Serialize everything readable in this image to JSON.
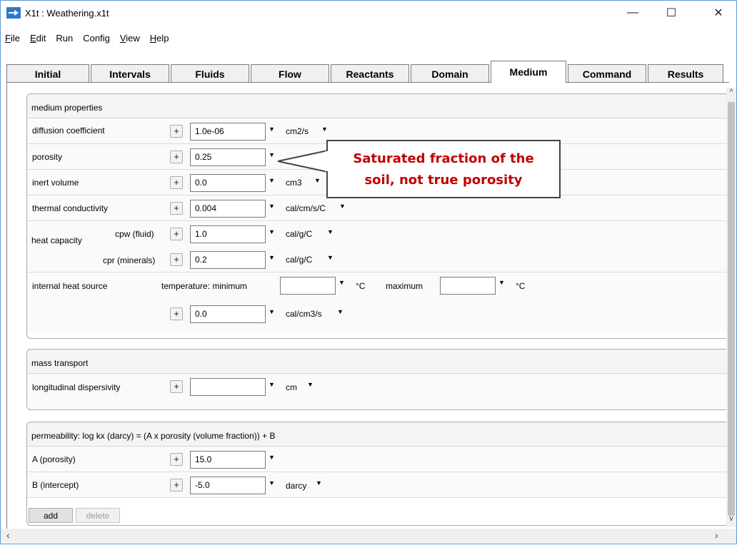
{
  "window": {
    "title": "X1t : Weathering.x1t",
    "min_glyph": "—",
    "max_glyph": "☐",
    "close_glyph": "✕"
  },
  "menu": [
    {
      "mnemonic": "F",
      "rest": "ile"
    },
    {
      "mnemonic": "E",
      "rest": "dit"
    },
    {
      "mnemonic": "",
      "rest": "Run"
    },
    {
      "mnemonic": "",
      "rest": "Config"
    },
    {
      "mnemonic": "V",
      "rest": "iew"
    },
    {
      "mnemonic": "H",
      "rest": "elp"
    }
  ],
  "tabs": [
    "Initial",
    "Intervals",
    "Fluids",
    "Flow",
    "Reactants",
    "Domain",
    "Medium",
    "Command",
    "Results"
  ],
  "active_tab": "Medium",
  "medium": {
    "title": "medium properties",
    "diffusion": {
      "label": "diffusion coefficient",
      "value": "1.0e-06",
      "unit": "cm2/s"
    },
    "porosity": {
      "label": "porosity",
      "value": "0.25"
    },
    "inert": {
      "label": "inert volume",
      "value": "0.0",
      "unit": "cm3"
    },
    "thermal": {
      "label": "thermal conductivity",
      "value": "0.004",
      "unit": "cal/cm/s/C"
    },
    "heat": {
      "label": "heat capacity",
      "cpw_label": "cpw (fluid)",
      "cpw_value": "1.0",
      "cpw_unit": "cal/g/C",
      "cpr_label": "cpr (minerals)",
      "cpr_value": "0.2",
      "cpr_unit": "cal/g/C"
    },
    "heat_source": {
      "label": "internal heat source",
      "temp_label": "temperature:  minimum",
      "min_value": "",
      "min_unit": "°C",
      "max_label": "maximum",
      "max_value": "",
      "max_unit": "°C",
      "value": "0.0",
      "unit": "cal/cm3/s"
    }
  },
  "mass": {
    "title": "mass transport",
    "dispersivity": {
      "label": "longitudinal dispersivity",
      "value": "",
      "unit": "cm"
    }
  },
  "perm": {
    "title": "permeability: log kx (darcy) = (A x porosity (volume fraction)) + B",
    "a": {
      "label": "A (porosity)",
      "value": "15.0"
    },
    "b": {
      "label": "B (intercept)",
      "value": "-5.0",
      "unit": "darcy"
    },
    "add_label": "add",
    "delete_label": "delete"
  },
  "callout": {
    "line1": "Saturated fraction of the",
    "line2": "soil, not true porosity"
  },
  "colors": {
    "accent": "#2e78d2",
    "callout_text": "#c00000"
  }
}
